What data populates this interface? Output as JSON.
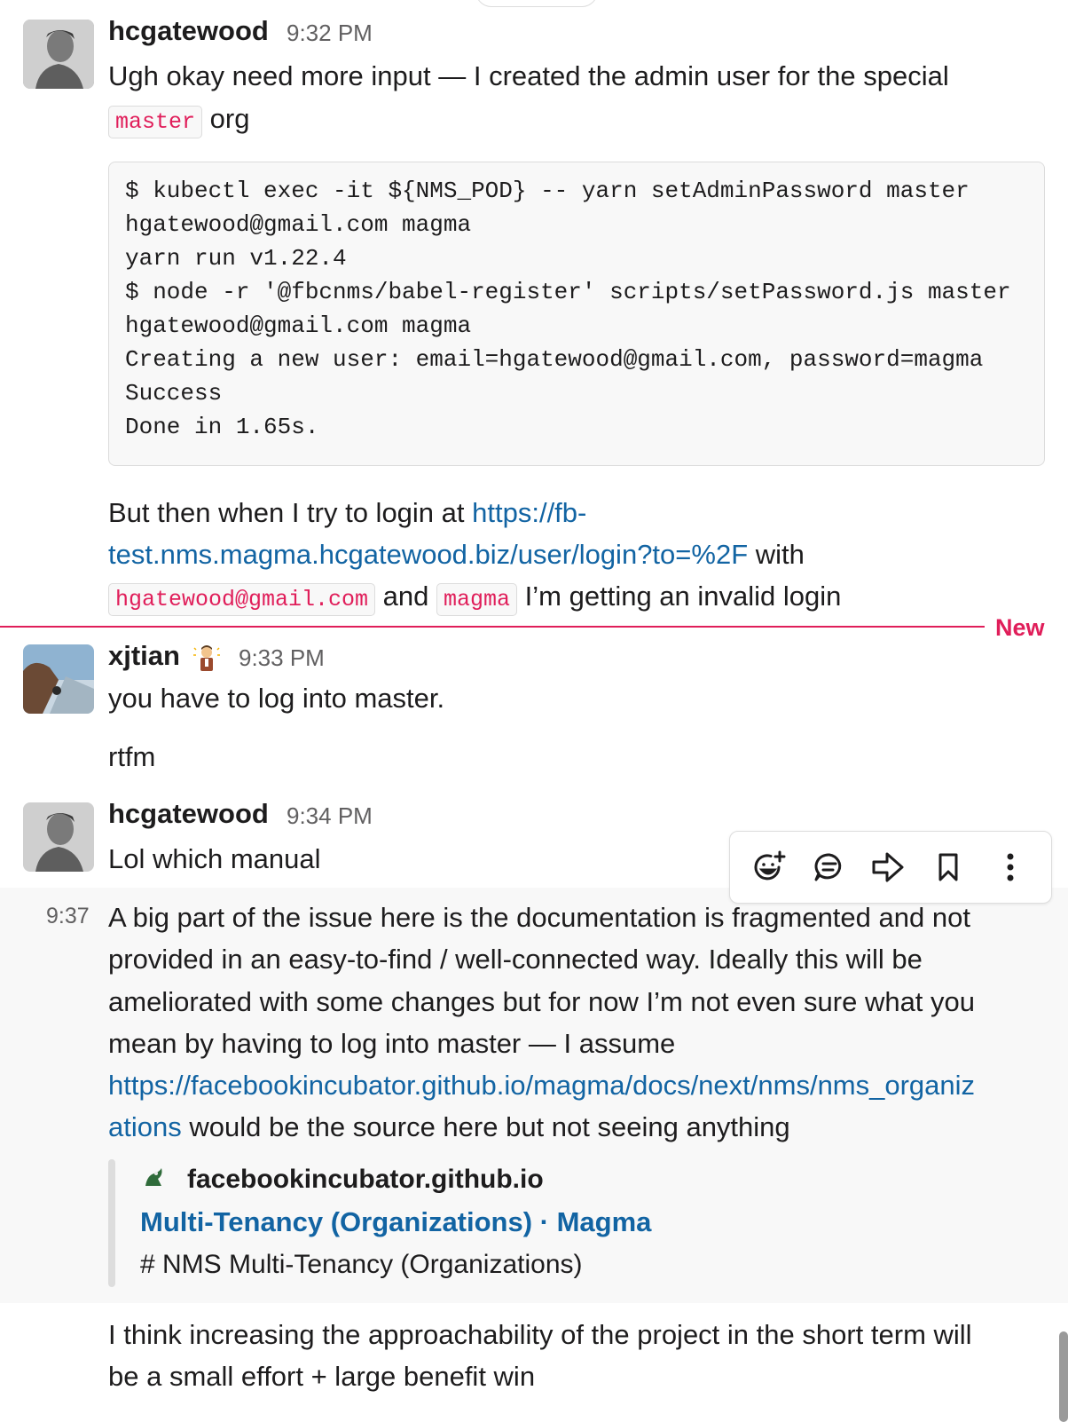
{
  "messages": {
    "m1": {
      "username": "hcgatewood",
      "time": "9:32 PM",
      "line1": "Ugh okay need more input — I created the admin user for the special",
      "code1": "master",
      "after1": "org",
      "codeblock": [
        "$ kubectl exec -it ${NMS_POD} -- yarn setAdminPassword master",
        "hgatewood@gmail.com magma",
        "yarn run v1.22.4",
        "$ node -r '@fbcnms/babel-register' scripts/setPassword.js master",
        "hgatewood@gmail.com magma",
        "Creating a new user: email=hgatewood@gmail.com, password=magma",
        "Success",
        "Done in 1.65s."
      ],
      "p2_text1": "But then when I try to login at ",
      "p2_link1": "https://fb-",
      "p2_link2": "test.nms.magma.hcgatewood.biz/user/login?to=%2F",
      "p2_text2": " with",
      "p2_code1": "hgatewood@gmail.com",
      "p2_text3": "and",
      "p2_code2": "magma",
      "p2_text4": "I’m getting an invalid login"
    },
    "new_divider": "New",
    "m2": {
      "username": "xjtian",
      "time": "9:33 PM",
      "text1": "you have to log into master.",
      "text2": "rtfm"
    },
    "m3": {
      "username": "hcgatewood",
      "time": "9:34 PM",
      "text": "Lol which manual"
    },
    "m4": {
      "time": "9:37",
      "lines": [
        "A big part of the issue here is the documentation is fragmented and not",
        "provided in an easy-to-find / well-connected way. Ideally this will be",
        "ameliorated with some changes but for now I’m not even sure what you",
        "mean by having to log into master — I assume"
      ],
      "link_line1": "https://facebookincubator.github.io/magma/docs/next/nms/nms_organiz",
      "link_line2": "ations",
      "after_link": " would be the source here but not seeing anything",
      "unfurl": {
        "site": "facebookincubator.github.io",
        "title": "Multi-Tenancy (Organizations) · Magma",
        "description": "# NMS Multi-Tenancy (Organizations)"
      }
    },
    "m5": {
      "line1": "I think increasing the approachability of the project in the short term will",
      "line2": "be a small effort + large benefit win"
    }
  },
  "toolbar": {
    "icons": [
      "add-reaction-icon",
      "reply-in-thread-icon",
      "share-message-icon",
      "bookmark-icon",
      "more-actions-icon"
    ]
  },
  "colors": {
    "link": "#1264a3",
    "code": "#e01e5a",
    "new_divider": "#e01e5a",
    "hover_bg": "#f8f8f8"
  }
}
